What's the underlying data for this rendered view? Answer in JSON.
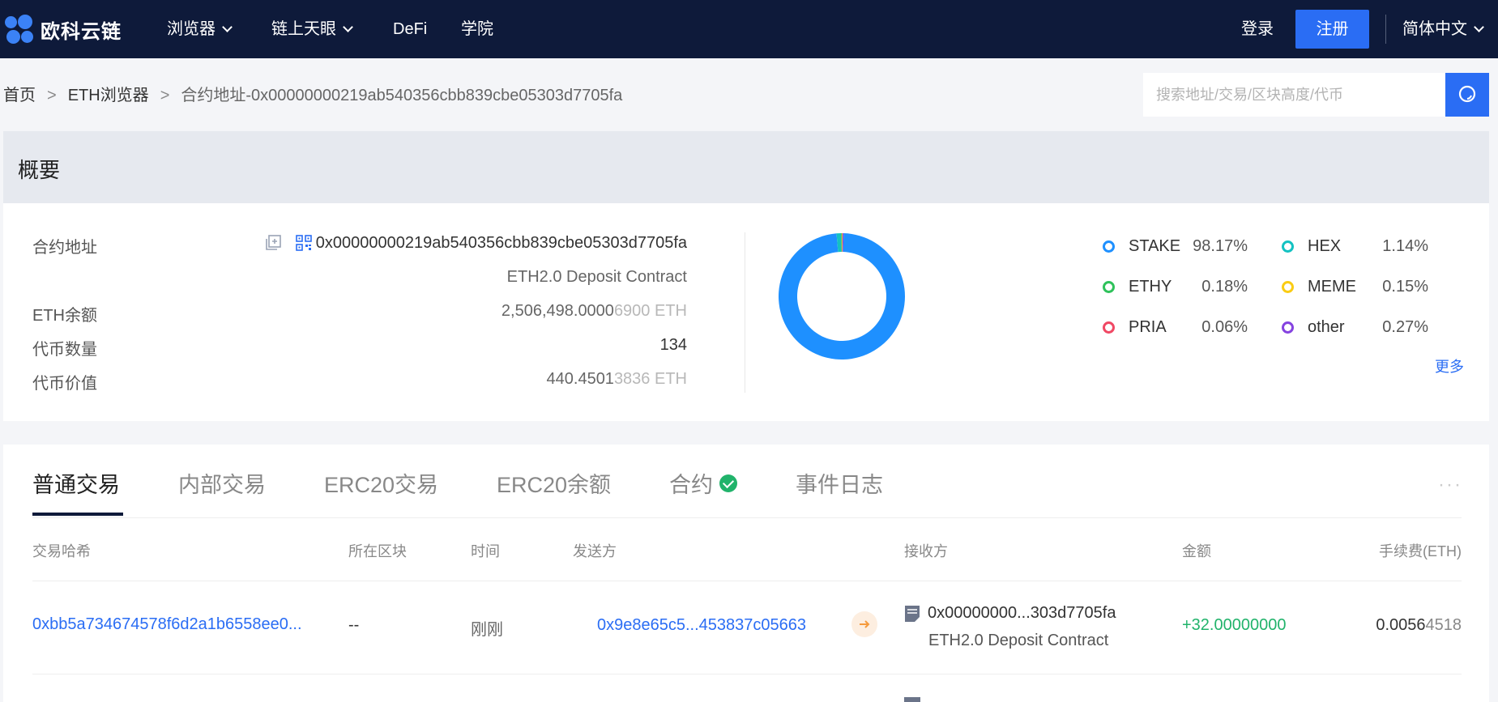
{
  "nav": {
    "logo_text": "欧科云链",
    "items": [
      "浏览器",
      "链上天眼",
      "DeFi",
      "学院"
    ],
    "login": "登录",
    "register": "注册",
    "language": "简体中文"
  },
  "breadcrumb": {
    "home": "首页",
    "separator": ">",
    "browser": "ETH浏览器",
    "current": "合约地址-0x00000000219ab540356cbb839cbe05303d7705fa"
  },
  "search": {
    "placeholder": "搜索地址/交易/区块高度/代币"
  },
  "overview": {
    "title": "概要",
    "contract_label": "合约地址",
    "contract_address": "0x00000000219ab540356cbb839cbe05303d7705fa",
    "contract_name": "ETH2.0 Deposit Contract",
    "balance_label": "ETH余额",
    "balance_main": "2,506,498.0000",
    "balance_dim": "6900 ETH",
    "token_count_label": "代币数量",
    "token_count": "134",
    "token_value_label": "代币价值",
    "token_value_main": "440.4501",
    "token_value_dim": "3836 ETH",
    "more": "更多"
  },
  "chart_data": {
    "type": "pie",
    "donut": true,
    "categories": [
      "STAKE",
      "HEX",
      "ETHY",
      "MEME",
      "PRIA",
      "other"
    ],
    "values": [
      98.17,
      1.14,
      0.18,
      0.15,
      0.06,
      0.27
    ],
    "labels": [
      "98.17%",
      "1.14%",
      "0.18%",
      "0.15%",
      "0.06%",
      "0.27%"
    ],
    "colors": [
      "#1e90ff",
      "#13c2c2",
      "#2fc25b",
      "#facc14",
      "#f04864",
      "#8543e0"
    ]
  },
  "tabs": [
    {
      "label": "普通交易",
      "active": true
    },
    {
      "label": "内部交易",
      "active": false
    },
    {
      "label": "ERC20交易",
      "active": false
    },
    {
      "label": "ERC20余额",
      "active": false
    },
    {
      "label": "合约",
      "active": false
    },
    {
      "label": "事件日志",
      "active": false
    }
  ],
  "table": {
    "headers": [
      "交易哈希",
      "所在区块",
      "时间",
      "发送方",
      "接收方",
      "金额",
      "手续费(ETH)"
    ],
    "rows": [
      {
        "hash": "0xbb5a734674578f6d2a1b6558ee0...",
        "block": "--",
        "time": "刚刚",
        "from": "0x9e8e65c5...453837c05663",
        "to": "0x00000000...303d7705fa",
        "to_name": "ETH2.0 Deposit Contract",
        "amount": "+32.00000000",
        "fee_main": "0.0056",
        "fee_dim": "4518"
      }
    ]
  }
}
